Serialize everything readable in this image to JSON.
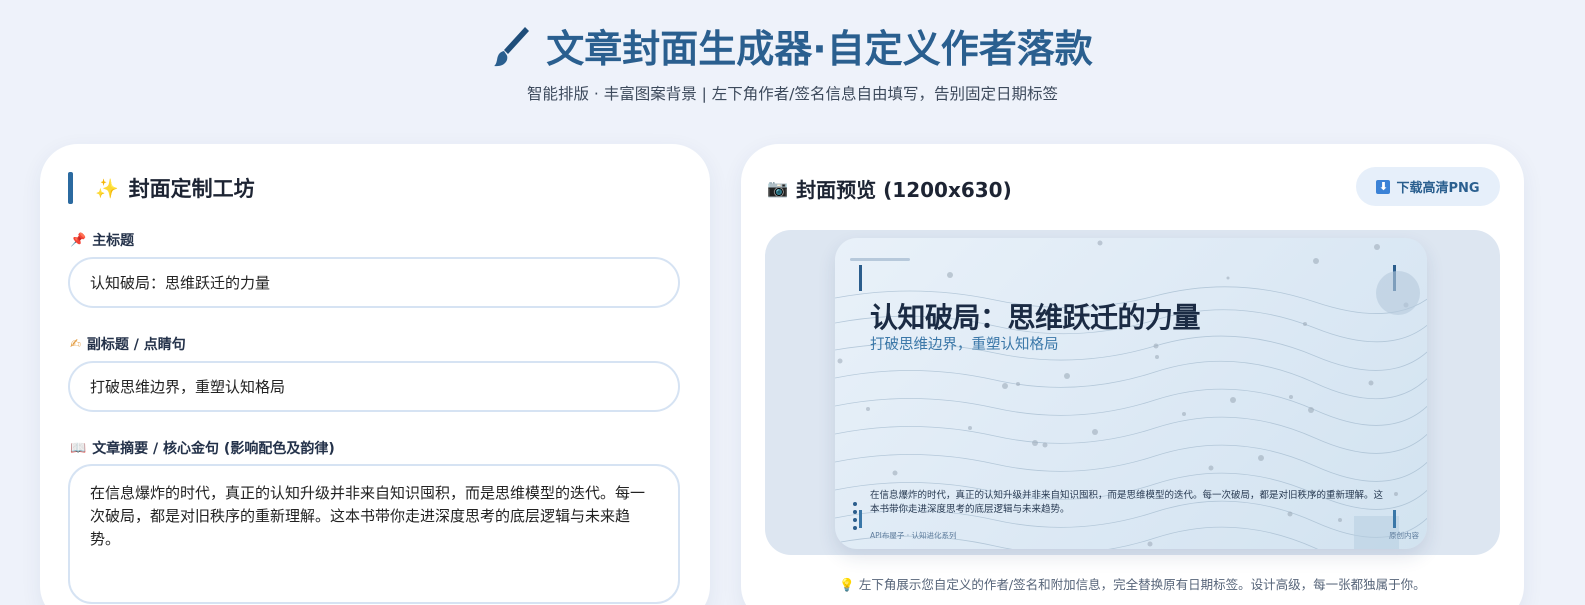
{
  "header": {
    "title": "文章封面生成器·自定义作者落款",
    "subtitle": "智能排版 · 丰富图案背景 | 左下角作者/签名信息自由填写，告别固定日期标签"
  },
  "form": {
    "section_title": "封面定制工坊",
    "title_label": "主标题",
    "title_value": "认知破局：思维跃迁的力量",
    "subtitle_label": "副标题 / 点睛句",
    "subtitle_value": "打破思维边界，重塑认知格局",
    "summary_label": "文章摘要 / 核心金句 (影响配色及韵律)",
    "summary_value": "在信息爆炸的时代，真正的认知升级并非来自知识囤积，而是思维模型的迭代。每一次破局，都是对旧秩序的重新理解。这本书带你走进深度思考的底层逻辑与未来趋势。"
  },
  "preview": {
    "title": "封面预览 (1200x630)",
    "download_label": "下载高清PNG",
    "tip": "左下角展示您自定义的作者/签名和附加信息，完全替换原有日期标签。设计高级，每一张都独属于你。"
  },
  "cover": {
    "title": "认知破局：思维跃迁的力量",
    "subtitle": "打破思维边界，重塑认知格局",
    "summary": "在信息爆炸的时代，真正的认知升级并非来自知识囤积，而是思维模型的迭代。每一次破局，都是对旧秩序的重新理解。这本书带你走进深度思考的底层逻辑与未来趋势。",
    "author": "API布屋子 · 认知进化系列",
    "extra": "原创内容"
  },
  "icons": {
    "header": "paintbrush-icon",
    "section": "sparkles-icon",
    "title_field": "pushpin-icon",
    "subtitle_field": "writing-hand-icon",
    "summary_field": "open-book-icon",
    "preview": "camera-icon",
    "download": "download-icon",
    "tip": "lightbulb-icon"
  },
  "colors": {
    "accent": "#2a5f8f",
    "page_bg": "#eef2fa",
    "field_border": "#d6e3f3"
  }
}
